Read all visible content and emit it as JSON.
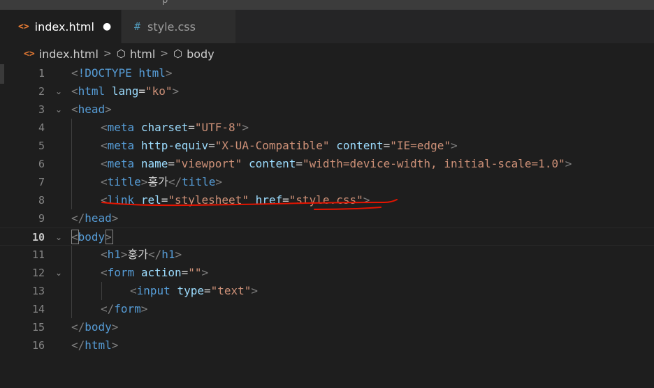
{
  "window": {
    "title_fragment": "p"
  },
  "tabs": [
    {
      "icon": "html-file-icon",
      "label": "index.html",
      "active": true,
      "dirty_marker": "●"
    },
    {
      "icon": "css-file-icon",
      "label": "style.css",
      "active": false
    }
  ],
  "breadcrumbs": [
    {
      "icon": "html-file-icon",
      "label": "index.html"
    },
    {
      "icon": "element-icon",
      "label": "html"
    },
    {
      "icon": "element-icon",
      "label": "body"
    }
  ],
  "editor": {
    "current_line": 10,
    "lines": [
      {
        "num": "1",
        "fold": "",
        "tokens": [
          "<!DOCTYPE html>"
        ]
      },
      {
        "num": "2",
        "fold": "⌄",
        "tokens": [
          "<html lang=\"ko\">"
        ]
      },
      {
        "num": "3",
        "fold": "⌄",
        "tokens": [
          "<head>"
        ]
      },
      {
        "num": "4",
        "fold": "",
        "tokens": [
          "<meta charset=\"UTF-8\">"
        ]
      },
      {
        "num": "5",
        "fold": "",
        "tokens": [
          "<meta http-equiv=\"X-UA-Compatible\" content=\"IE=edge\">"
        ]
      },
      {
        "num": "6",
        "fold": "",
        "tokens": [
          "<meta name=\"viewport\" content=\"width=device-width, initial-scale=1.0\">"
        ]
      },
      {
        "num": "7",
        "fold": "",
        "tokens": [
          "<title>홍가</title>"
        ]
      },
      {
        "num": "8",
        "fold": "",
        "tokens": [
          "<link rel=\"stylesheet\" href=\"style.css\">"
        ]
      },
      {
        "num": "9",
        "fold": "",
        "tokens": [
          "</head>"
        ]
      },
      {
        "num": "10",
        "fold": "⌄",
        "tokens": [
          "<body>"
        ]
      },
      {
        "num": "11",
        "fold": "",
        "tokens": [
          "<h1>홍가</h1>"
        ]
      },
      {
        "num": "12",
        "fold": "⌄",
        "tokens": [
          "<form action=\"\">"
        ]
      },
      {
        "num": "13",
        "fold": "",
        "tokens": [
          "<input type=\"text\">"
        ]
      },
      {
        "num": "14",
        "fold": "",
        "tokens": [
          "</form>"
        ]
      },
      {
        "num": "15",
        "fold": "",
        "tokens": [
          "</body>"
        ]
      },
      {
        "num": "16",
        "fold": "",
        "tokens": [
          "</html>"
        ]
      }
    ]
  },
  "colors": {
    "background": "#1e1e1e",
    "tag": "#569cd6",
    "bracket": "#808080",
    "attribute": "#9cdcfe",
    "string": "#ce9178",
    "text": "#d4d4d4",
    "annotation": "#e51400"
  }
}
